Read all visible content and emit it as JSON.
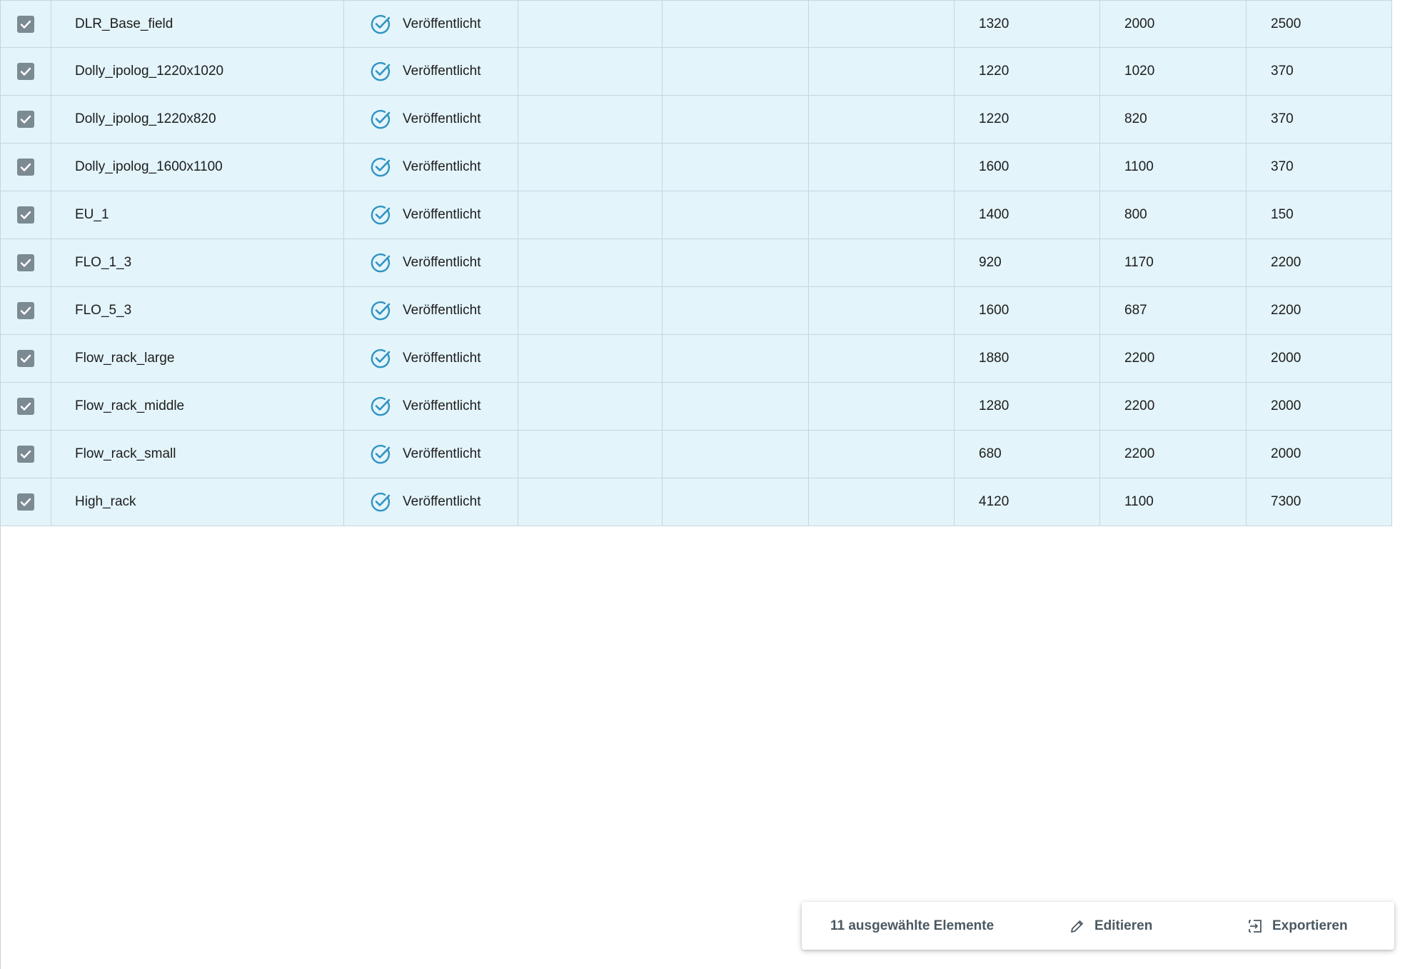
{
  "table": {
    "rows": [
      {
        "name": "DLR_Base_field",
        "status": "Veröffentlicht",
        "v1": "1320",
        "v2": "2000",
        "v3": "2500"
      },
      {
        "name": "Dolly_ipolog_1220x1020",
        "status": "Veröffentlicht",
        "v1": "1220",
        "v2": "1020",
        "v3": "370"
      },
      {
        "name": "Dolly_ipolog_1220x820",
        "status": "Veröffentlicht",
        "v1": "1220",
        "v2": "820",
        "v3": "370"
      },
      {
        "name": "Dolly_ipolog_1600x1100",
        "status": "Veröffentlicht",
        "v1": "1600",
        "v2": "1100",
        "v3": "370"
      },
      {
        "name": "EU_1",
        "status": "Veröffentlicht",
        "v1": "1400",
        "v2": "800",
        "v3": "150"
      },
      {
        "name": "FLO_1_3",
        "status": "Veröffentlicht",
        "v1": "920",
        "v2": "1170",
        "v3": "2200"
      },
      {
        "name": "FLO_5_3",
        "status": "Veröffentlicht",
        "v1": "1600",
        "v2": "687",
        "v3": "2200"
      },
      {
        "name": "Flow_rack_large",
        "status": "Veröffentlicht",
        "v1": "1880",
        "v2": "2200",
        "v3": "2000"
      },
      {
        "name": "Flow_rack_middle",
        "status": "Veröffentlicht",
        "v1": "1280",
        "v2": "2200",
        "v3": "2000"
      },
      {
        "name": "Flow_rack_small",
        "status": "Veröffentlicht",
        "v1": "680",
        "v2": "2200",
        "v3": "2000"
      },
      {
        "name": "High_rack",
        "status": "Veröffentlicht",
        "v1": "4120",
        "v2": "1100",
        "v3": "7300"
      }
    ]
  },
  "action_bar": {
    "selected_count": "11 ausgewählte Elemente",
    "edit_label": "Editieren",
    "export_label": "Exportieren"
  },
  "icons": {
    "checkbox": "checkbox-checked-icon",
    "status": "check-circle-icon",
    "edit": "pencil-icon",
    "export": "export-icon"
  },
  "colors": {
    "row_background": "#e3f4fa",
    "checkbox": "#7c8a92",
    "status_icon": "#2f93c4",
    "action_text": "#4b5861"
  }
}
